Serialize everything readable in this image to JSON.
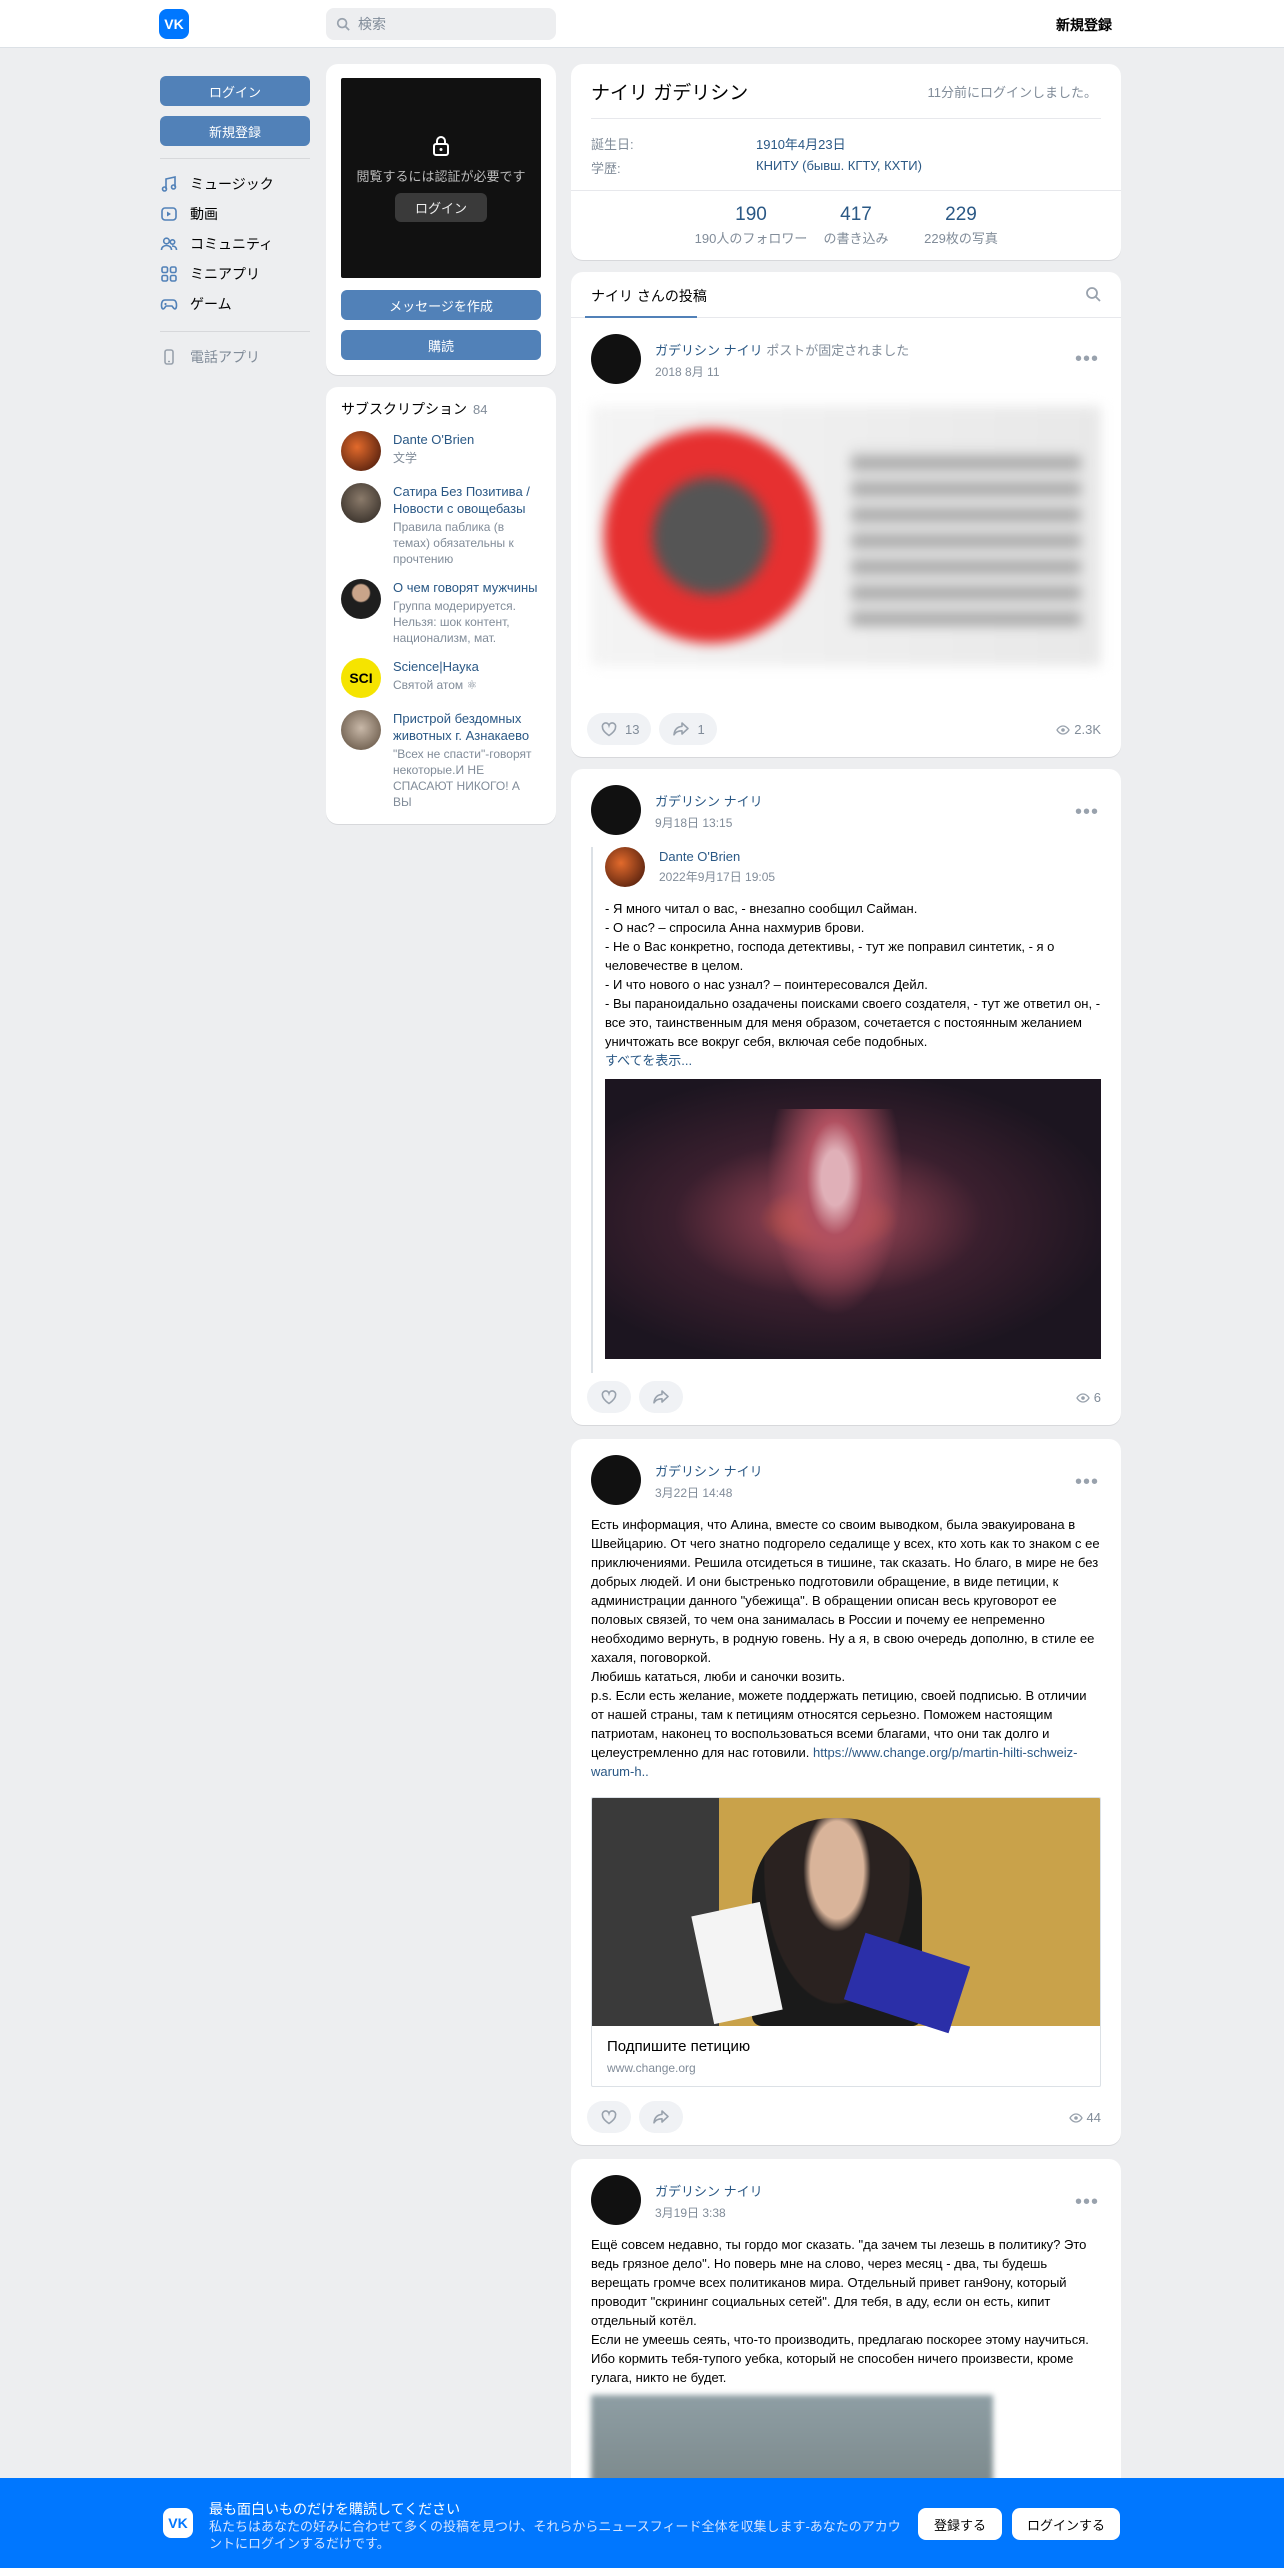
{
  "topbar": {
    "search_placeholder": "検索",
    "register_label": "新規登録",
    "logo_text": "VK"
  },
  "leftnav": {
    "login_label": "ログイン",
    "register_label": "新規登録",
    "items": [
      {
        "label": "ミュージック",
        "icon": "music-icon"
      },
      {
        "label": "動画",
        "icon": "video-icon"
      },
      {
        "label": "コミュニティ",
        "icon": "community-icon"
      },
      {
        "label": "ミニアプリ",
        "icon": "miniapps-icon"
      },
      {
        "label": "ゲーム",
        "icon": "game-icon"
      }
    ],
    "phone_app": "電話アプリ"
  },
  "profile_photo": {
    "locked_message": "閲覧するには認証が必要です",
    "login_label": "ログイン",
    "message_label": "メッセージを作成",
    "subscribe_label": "購読"
  },
  "subscriptions": {
    "title": "サブスクリプション",
    "count": "84",
    "items": [
      {
        "name": "Dante O'Brien",
        "desc": "文学",
        "avatar_color": "#6b2a18"
      },
      {
        "name": "Сатира Без Позитива / Новости с овощебазы",
        "desc": "Правила паблика (в темах) обязательны к прочтению",
        "avatar_color": "#4a3b2f"
      },
      {
        "name": "О чем говорят мужчины",
        "desc": "Группа модерируется. Нельзя: шок контент, национализм, мат.",
        "avatar_color": "#2b2b2b"
      },
      {
        "name": "Science|Наука",
        "desc": "Святой атом ⚛",
        "avatar_color": "#f5e400",
        "avatar_text": "SCI"
      },
      {
        "name": "Пристрой бездомных животных г. Азнакаево",
        "desc": "\"Всех не спасти\"-говорят некоторые.И НЕ СПАСАЮТ НИКОГО! А ВЫ",
        "avatar_color": "#8a7a6a"
      }
    ]
  },
  "profile": {
    "name": "ナイリ ガデリシン",
    "last_seen": "11分前にログインしました。",
    "birthday_label": "誕生日:",
    "birthday_value": "1910年4月23日",
    "education_label": "学歴:",
    "education_value": "КНИТУ (бывш. КГТУ, КХТИ)",
    "counters": [
      {
        "num": "190",
        "label": "190人のフォロワー"
      },
      {
        "num": "417",
        "label": "の書き込み"
      },
      {
        "num": "229",
        "label": "229枚の写真"
      }
    ]
  },
  "wall": {
    "tab_label": "ナイリ さんの投稿"
  },
  "posts": [
    {
      "author": "ガデリシン ナイリ",
      "action": "ポストが固定されました",
      "date": "2018 8月 11",
      "likes": "13",
      "shares": "1",
      "views": "2.3K"
    },
    {
      "author": "ガデリシン ナイリ",
      "date": "9月18日 13:15",
      "repost_author": "Dante O'Brien",
      "repost_date": "2022年9月17日 19:05",
      "text": "- Я много читал о вас, - внезапно сообщил Сайман.\n- О нас? – спросила Анна нахмурив брови.\n- Не о Вас конкретно, господа детективы, - тут же поправил синтетик, - я о человечестве в целом.\n- И что нового о нас узнал? – поинтересовался Дейл.\n- Вы параноидально озадачены поисками своего создателя, - тут же ответил он, - все это, таинственным для меня образом, сочетается с постоянным желанием уничтожать все вокруг себя, включая себе подобных.",
      "show_more": "すべてを表示...",
      "views": "6"
    },
    {
      "author": "ガデリシン ナイリ",
      "date": "3月22日 14:48",
      "text": "Есть информация, что Алина, вместе со своим выводком, была эвакуирована в Швейцарию. От чего знатно подгорело седалище у всех, кто хоть как то знаком с ее приключениями. Решила отсидеться в тишине, так сказать. Но благо, в мире не без добрых людей. И они быстренько подготовили обращение, в виде петиции, к администрации данного \"убежища\". В обращении описан весь круговорот ее половых связей, то чем она занималась в России и почему ее непременно необходимо вернуть, в родную говень. Ну а я, в свою очередь дополню, в стиле ее хахаля, поговоркой.\nЛюбишь кататься, люби и саночки возить.\np.s. Если есть желание, можете поддержать петицию, своей подписью. В отличии от нашей страны, там к петициям относятся серьезно. Поможем настоящим патриотам, наконец то воспользоваться всеми благами, что они так долго и целеустремленно для нас готовили. ",
      "link": "https://www.change.org/p/martin-hilti-schweiz-warum-h..",
      "snippet_title": "Подпишите петицию",
      "snippet_domain": "www.change.org",
      "views": "44"
    },
    {
      "author": "ガデリシン ナイリ",
      "date": "3月19日 3:38",
      "text": "Ещё совсем недавно, ты гордо мог сказать. \"да зачем ты лезешь в политику? Это ведь грязное дело\". Но поверь мне на слово, через месяц - два, ты будешь верещать громче всех политиканов мира. Отдельный привет ган9ону, который проводит \"скрининг социальных сетей\". Для тебя, в аду, если он есть, кипит отдельный котёл.\nЕсли не умеешь сеять, что-то производить, предлагаю поскорее этому научиться. Ибо кормить тебя-тупого уебка, который не способен ничего произвести, кроме гулага, никто не будет."
    }
  ],
  "footer": {
    "title": "最も面白いものだけを購読してください",
    "desc": "私たちはあなたの好みに合わせて多くの投稿を見つけ、それらからニュースフィード全体を収集します-あなたのアカウントにログインするだけです。",
    "register_label": "登録する",
    "login_label": "ログインする"
  }
}
